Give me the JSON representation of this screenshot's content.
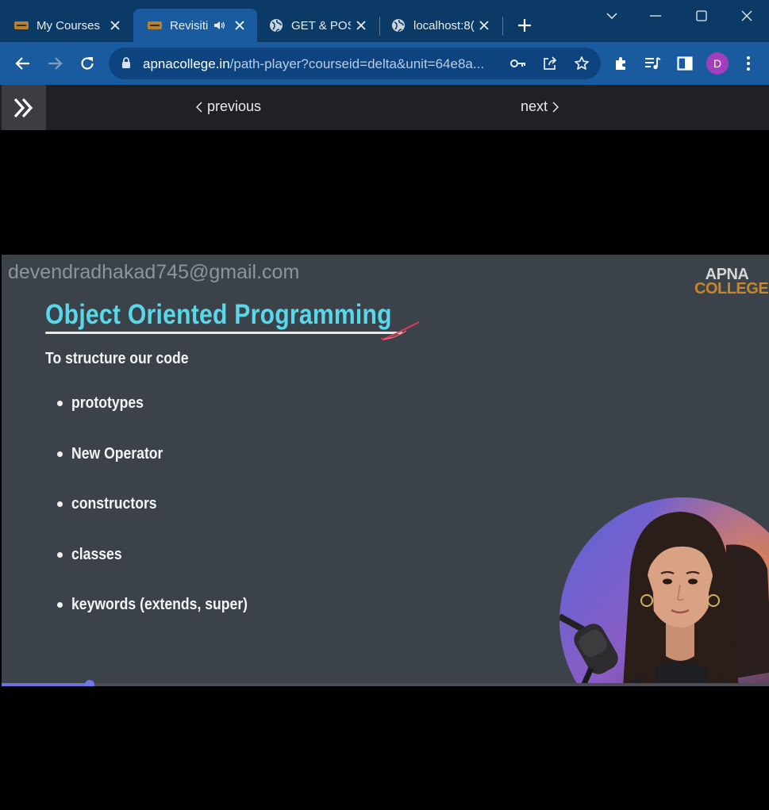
{
  "browser": {
    "tabs": [
      {
        "title": "My Courses",
        "favicon": "apna-college-favicon",
        "active": false
      },
      {
        "title": "Revisiti",
        "favicon": "apna-college-favicon",
        "active": true,
        "audio": true
      },
      {
        "title": "GET & POS",
        "favicon": "globe-icon",
        "active": false
      },
      {
        "title": "localhost:8(",
        "favicon": "globe-icon",
        "active": false
      }
    ],
    "url": {
      "host": "apnacollege.in",
      "path": "/path-player?courseid=delta&unit=64e8a..."
    },
    "profile_initial": "D",
    "colors": {
      "tabstrip": "#0c3a66",
      "toolbar": "#1a5ba0",
      "avatar": "#a13fbd"
    }
  },
  "player": {
    "previous_label": "previous",
    "next_label": "next"
  },
  "slide": {
    "watermark": "devendradhakad745@gmail.com",
    "logo_line1": "APNA",
    "logo_line2": "COLLEGE",
    "title": "Object Oriented Programming",
    "subtitle": "To structure our code",
    "bullets": [
      "prototypes",
      "New Operator",
      "constructors",
      "classes",
      "keywords (extends, super)"
    ],
    "colors": {
      "background": "#3b424a",
      "title": "#5ad8ea",
      "logo_accent": "#c8862c"
    }
  },
  "video_progress": 0.115
}
